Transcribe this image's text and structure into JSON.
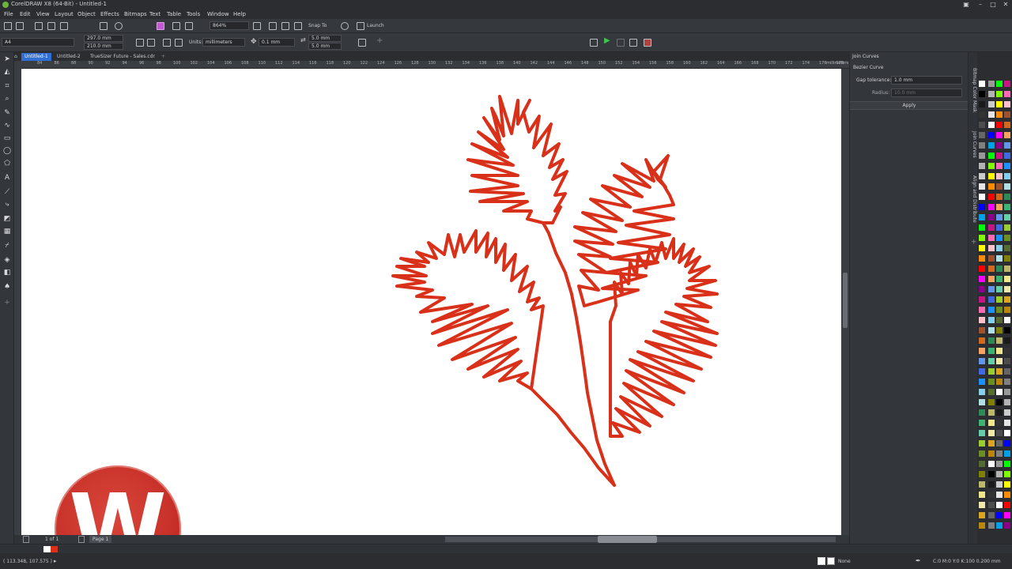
{
  "window": {
    "title": "CorelDRAW X8 (64-Bit) - Untitled-1"
  },
  "menu": [
    "File",
    "Edit",
    "View",
    "Layout",
    "Object",
    "Effects",
    "Bitmaps",
    "Text",
    "Table",
    "Tools",
    "Window",
    "Help"
  ],
  "toolbar": {
    "zoom": "864%",
    "snap_to": "Snap To",
    "launch": "Launch"
  },
  "property_bar": {
    "page_size": "A4",
    "width": "297.0 mm",
    "height": "210.0 mm",
    "units_label": "Units:",
    "units": "millimeters",
    "nudge": "0.1 mm",
    "dup_x": "5.0 mm",
    "dup_y": "5.0 mm"
  },
  "tabs": [
    {
      "label": "Untitled-1",
      "active": true
    },
    {
      "label": "Untitled-2",
      "active": false
    },
    {
      "label": "TrueSizer Future - Sales.cdr",
      "active": false
    }
  ],
  "ruler": {
    "ticks": [
      "84",
      "86",
      "88",
      "90",
      "92",
      "94",
      "96",
      "98",
      "100",
      "102",
      "104",
      "106",
      "108",
      "110",
      "112",
      "114",
      "116",
      "118",
      "120",
      "122",
      "124",
      "126",
      "128",
      "130",
      "132",
      "134",
      "136",
      "138",
      "140",
      "142",
      "144",
      "146",
      "148",
      "150",
      "152",
      "154",
      "156",
      "158",
      "160",
      "162",
      "164",
      "166",
      "168",
      "170",
      "172",
      "174",
      "176",
      "178"
    ],
    "unit": "millimeters"
  },
  "docker": {
    "title": "Join Curves",
    "mode": "Bezier Curve",
    "gap_label": "Gap tolerance:",
    "gap_value": "1.0 mm",
    "radius_label": "Radius:",
    "radius_value": "10.0 mm",
    "apply": "Apply"
  },
  "vertical_tabs": [
    "Bitmap Color Mask",
    "Join Curves",
    "Align and Distribute"
  ],
  "page_nav": {
    "current": "1",
    "of": "of",
    "total": "1",
    "page_tab": "Page 1"
  },
  "status": {
    "coords": "( 113.348, 107.575 )",
    "color_info": "C:0 M:0 Y:0 K:100  0.200 mm",
    "fill": "None"
  },
  "colors": {
    "accent": "#2f6fd6",
    "stroke": "#d9301a",
    "logo_red": "#c8322a"
  },
  "logo": {
    "letter": "W"
  },
  "palette": [
    "#ffffff",
    "#000000",
    "#1a1a1a",
    "#333333",
    "#4d4d4d",
    "#666666",
    "#808080",
    "#999999",
    "#b3b3b3",
    "#cccccc",
    "#e6e6e6",
    "#ffffff",
    "#0000ff",
    "#00a0e9",
    "#00ff00",
    "#7fff00",
    "#ffff00",
    "#ff8c00",
    "#ff0000",
    "#ff00ff",
    "#8b008b",
    "#c71585",
    "#ff69b4",
    "#ffc0cb",
    "#a0522d",
    "#d2691e",
    "#f4a460",
    "#6495ed",
    "#4169e1",
    "#1e90ff",
    "#87ceeb",
    "#b0e0e6",
    "#2e8b57",
    "#3cb371",
    "#66cdaa",
    "#9acd32",
    "#6b8e23",
    "#556b2f",
    "#808000",
    "#bdb76b",
    "#f0e68c",
    "#eee8aa",
    "#daa520",
    "#b8860b"
  ]
}
